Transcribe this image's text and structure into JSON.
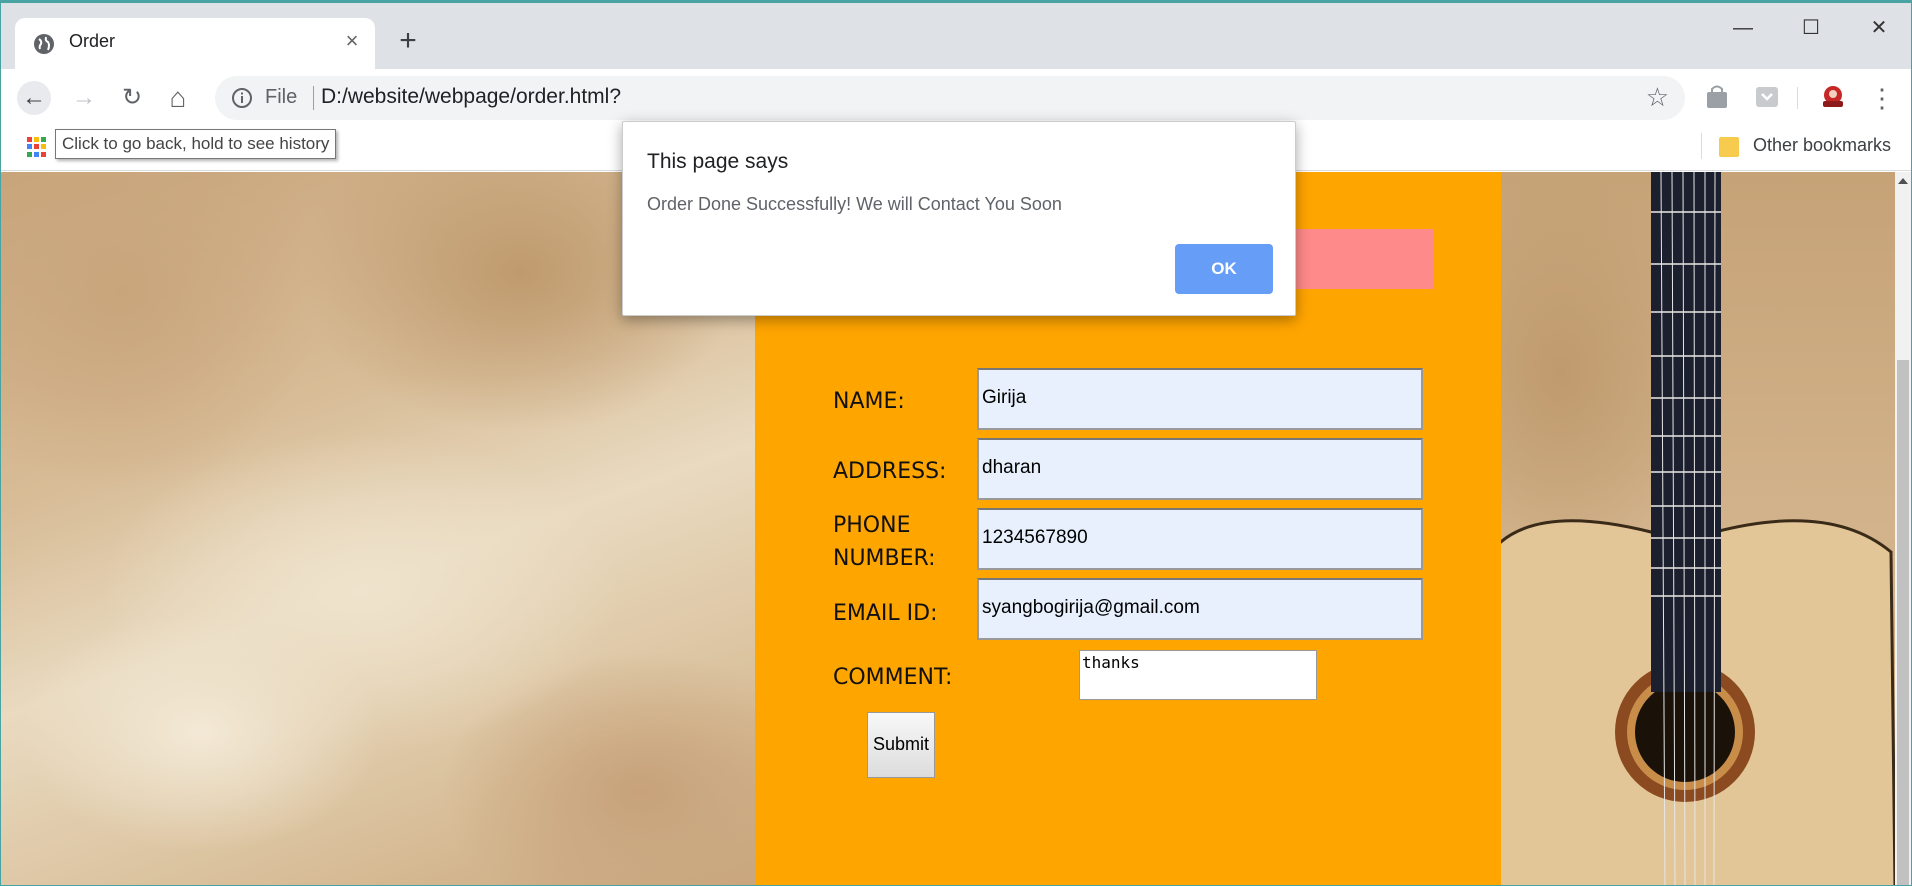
{
  "browser": {
    "tab_title": "Order",
    "tab_close": "×",
    "new_tab": "+",
    "address_prefix": "File",
    "url": "D:/website/webpage/order.html?",
    "star": "☆",
    "window_min": "—",
    "window_max": "☐",
    "window_close": "✕",
    "nav_back": "←",
    "nav_forward": "→",
    "nav_reload": "↻",
    "nav_home": "⌂"
  },
  "bookmarks": {
    "tooltip": "Click to go back, hold to see history",
    "other": "Other bookmarks"
  },
  "form": {
    "name_label": "NAME:",
    "name_value": "Girija",
    "address_label": "ADDRESS:",
    "address_value": "dharan",
    "phone_label_line1": "PHONE",
    "phone_label_line2": "NUMBER:",
    "phone_value": "1234567890",
    "email_label": "EMAIL ID:",
    "email_value": "syangbogirija@gmail.com",
    "comment_label": "COMMENT:",
    "comment_value": "thanks",
    "submit_label": "Submit"
  },
  "dialog": {
    "title": "This page says",
    "message": "Order Done Successfully! We will Contact You Soon",
    "ok_label": "OK"
  },
  "colors": {
    "order_panel": "#ffa500",
    "pink_header": "#ff8a8a",
    "ok_button": "#669df6",
    "input_bg": "#e8f0fe"
  }
}
